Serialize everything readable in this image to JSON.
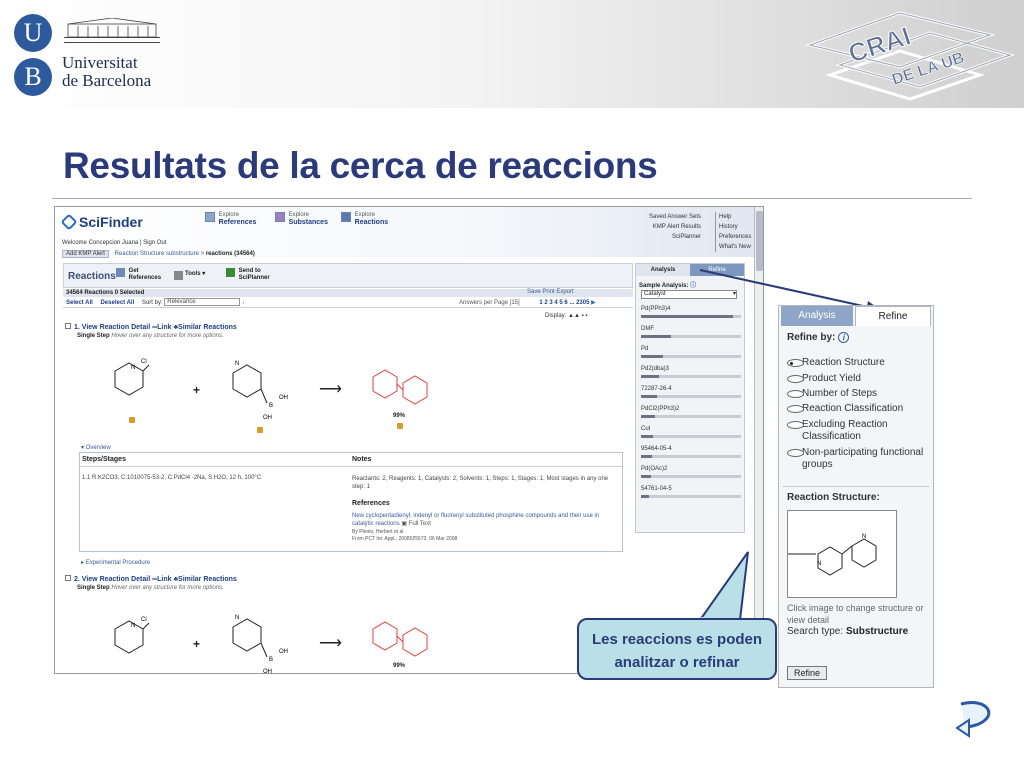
{
  "header": {
    "university_line1": "Universitat",
    "university_line2": "de Barcelona",
    "ub_letter_top": "U",
    "ub_letter_bottom": "B",
    "crai_word1": "CRAI",
    "crai_word2": "DE LA UB"
  },
  "slide": {
    "title": "Resultats de la cerca de reaccions"
  },
  "scifinder": {
    "logo": "SciFinder",
    "explore_refs_top": "Explore",
    "explore_refs": "References",
    "explore_subs_top": "Explore",
    "explore_subs": "Substances",
    "explore_reacs_top": "Explore",
    "explore_reacs": "Reactions",
    "right_links": [
      "Saved Answer Sets",
      "KMP Alert Results",
      "SciPlanner"
    ],
    "right_links2": [
      "Help",
      "History",
      "Preferences",
      "What's New"
    ],
    "welcome": "Welcome Concepcion Juana  |  Sign Out",
    "breadcrumb_btn": "Add KMP Alert",
    "breadcrumb_path": "Reaction Structure substructure  >",
    "breadcrumb_current": "reactions (34564)",
    "toolbar_title": "Reactions",
    "tool_get_refs_1": "Get",
    "tool_get_refs_2": "References",
    "tool_tools": "Tools",
    "tool_send_1": "Send to",
    "tool_send_2": "SciPlanner",
    "count_text": "34564 Reactions        0 Selected",
    "actions": "Save     Print     Export",
    "select_all": "Select All",
    "deselect_all": "Deselect All",
    "sort_by": "Sort by:",
    "sort_value": "Relevance",
    "answers_per_page": "Answers per Page [15]",
    "pages": "1  2  3  4  5  6 ...  2305",
    "display": "Display:",
    "results": [
      {
        "number": "1.",
        "link_detail": "View Reaction Detail",
        "link_link": "Link",
        "link_similar": "Similar Reactions",
        "single_step": "Single Step",
        "hint": "Hover over any structure for more options.",
        "yield": "99%"
      },
      {
        "number": "2.",
        "link_detail": "View Reaction Detail",
        "link_link": "Link",
        "link_similar": "Similar Reactions",
        "single_step": "Single Step",
        "hint": "Hover over any structure for more options.",
        "yield": "99%"
      }
    ],
    "overview_link": "Overview",
    "steps_heading": "Steps/Stages",
    "notes_heading": "Notes",
    "step_text": "1.1  R:K2CO3, C:1010075-53-2, C:PdCl4 ·2Na, S:H2O, 12 h, 100°C",
    "notes_text": "Reactants: 2, Reagents: 1, Catalysts: 2, Solvents: 1, Steps: 1, Stages: 1, Most stages in any one step: 1",
    "references_heading": "References",
    "ref_title": "New cyclopentadienyl, indenyl or fluorenyl substituted phosphine compounds and their use in catalytic reactions",
    "ref_fulltext": "Full Text",
    "ref_by": "By Plenio, Herbert et al",
    "ref_from": "From PCT Int. Appl., 2008025673, 06 Mar 2008",
    "experimental": "Experimental Procedure",
    "panel_tab_analysis": "Analysis",
    "panel_tab_refine": "Refine",
    "sample_analysis": "Sample Analysis:",
    "catalyst": "Catalyst",
    "catalysts": [
      {
        "label": "Pd(PPh3)4",
        "fraction": 0.92
      },
      {
        "label": "DMF",
        "fraction": 0.3
      },
      {
        "label": "Pd",
        "fraction": 0.22
      },
      {
        "label": "Pd2(dba)3",
        "fraction": 0.18
      },
      {
        "label": "72287-26-4",
        "fraction": 0.16
      },
      {
        "label": "PdCl2(PPh3)2",
        "fraction": 0.14
      },
      {
        "label": "CuI",
        "fraction": 0.12
      },
      {
        "label": "95464-05-4",
        "fraction": 0.11
      },
      {
        "label": "Pd(OAc)2",
        "fraction": 0.1
      },
      {
        "label": "54761-04-5",
        "fraction": 0.08
      }
    ]
  },
  "refine": {
    "tab_analysis": "Analysis",
    "tab_refine": "Refine",
    "refine_by": "Refine by:",
    "options": [
      {
        "label": "Reaction Structure",
        "selected": true
      },
      {
        "label": "Product Yield",
        "selected": false
      },
      {
        "label": "Number of Steps",
        "selected": false
      },
      {
        "label": "Reaction Classification",
        "selected": false
      },
      {
        "label": "Excluding Reaction Classification",
        "selected": false
      },
      {
        "label": "Non-participating functional groups",
        "selected": false
      }
    ],
    "structure_label": "Reaction Structure:",
    "click_hint": "Click image to change structure or view detail",
    "search_type_label": "Search type:",
    "search_type_value": "Substructure",
    "button": "Refine"
  },
  "callout": {
    "line1": "Les reaccions es poden",
    "line2": "analitzar o refinar"
  },
  "colors": {
    "title_blue": "#2b3a7a",
    "callout_bg": "#b8e0e6",
    "product_red": "#d8443c",
    "scifinder_blue": "#1d3f80"
  }
}
